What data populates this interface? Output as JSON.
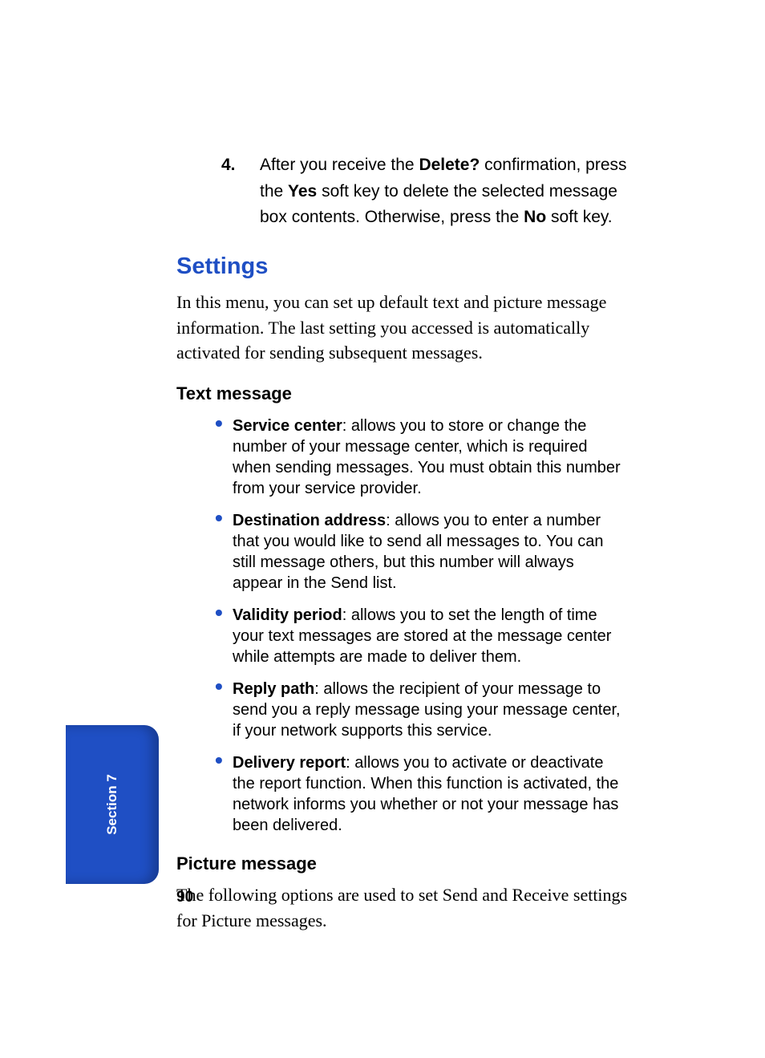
{
  "step4": {
    "number": "4.",
    "t1": "After you receive the ",
    "bold1": "Delete?",
    "t2": " confirmation, press the ",
    "bold2": "Yes",
    "t3": " soft key to delete the selected message box contents. Otherwise, press the ",
    "bold3": "No",
    "t4": " soft key."
  },
  "heading": "Settings",
  "intro": "In this menu, you can set up default text and picture message information. The last setting you accessed is automatically activated for sending subsequent messages.",
  "subheading1": "Text message",
  "bullets": [
    {
      "term": "Service center",
      "desc": ": allows you to store or change the number of your message center, which is required when sending messages. You must obtain this number from your service provider."
    },
    {
      "term": "Destination address",
      "desc": ": allows you to enter a number that you would like to send all messages to. You can still message others, but this number will always appear in the Send list."
    },
    {
      "term": "Validity period",
      "desc": ": allows you to set the length of time your text messages are stored at the message center while attempts are made to deliver them."
    },
    {
      "term": "Reply path",
      "desc": ": allows the recipient of your message to send you a reply message using your message center, if your network supports this service."
    },
    {
      "term": "Delivery report",
      "desc": ": allows you to activate or deactivate the report function. When this function is activated, the network informs you whether or not your message has been delivered."
    }
  ],
  "subheading2": "Picture message",
  "picture_intro": "The following options are used to set Send and Receive settings for Picture messages.",
  "page_number": "90",
  "section_tab": "Section 7"
}
